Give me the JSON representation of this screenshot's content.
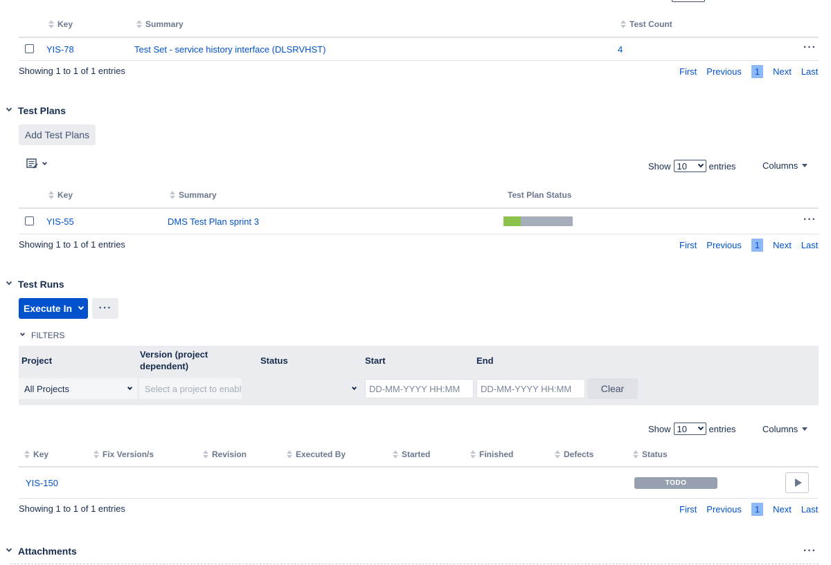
{
  "test_sets": {
    "columns": {
      "key": "Key",
      "summary": "Summary",
      "test_count": "Test Count"
    },
    "rows": [
      {
        "key": "YIS-78",
        "summary": "Test Set - service history interface (DLSRVHST)",
        "test_count": "4"
      }
    ],
    "showing": "Showing 1 to 1 of 1 entries"
  },
  "pager": {
    "first": "First",
    "previous": "Previous",
    "page": "1",
    "next": "Next",
    "last": "Last"
  },
  "test_plans": {
    "title": "Test Plans",
    "add_button": "Add Test Plans",
    "show_label": "Show",
    "show_value": "10",
    "entries_label": "entries",
    "columns_button": "Columns",
    "columns": {
      "key": "Key",
      "summary": "Summary",
      "status": "Test Plan Status"
    },
    "rows": [
      {
        "key": "YIS-55",
        "summary": "DMS Test Plan sprint 3",
        "passed_fraction": 0.25
      }
    ],
    "showing": "Showing 1 to 1 of 1 entries"
  },
  "test_runs": {
    "title": "Test Runs",
    "execute_button": "Execute In",
    "filters_label": "FILTERS",
    "filters": {
      "project_label": "Project",
      "project_value": "All Projects",
      "version_label": "Version (project dependent)",
      "version_placeholder": "Select a project to enable",
      "status_label": "Status",
      "start_label": "Start",
      "start_placeholder": "DD-MM-YYYY HH:MM",
      "end_label": "End",
      "end_placeholder": "DD-MM-YYYY HH:MM",
      "clear_button": "Clear"
    },
    "show_label": "Show",
    "show_value": "10",
    "entries_label": "entries",
    "columns_button": "Columns",
    "columns": {
      "key": "Key",
      "fix_version": "Fix Version/s",
      "revision": "Revision",
      "executed_by": "Executed By",
      "started": "Started",
      "finished": "Finished",
      "defects": "Defects",
      "status": "Status"
    },
    "rows": [
      {
        "key": "YIS-150",
        "status": "TODO"
      }
    ],
    "showing": "Showing 1 to 1 of 1 entries"
  },
  "attachments": {
    "title": "Attachments"
  },
  "colors": {
    "link": "#0052cc",
    "primary": "#0052cc",
    "passed": "#8bc34a",
    "remaining": "#a5adba",
    "todo": "#97a0af",
    "page_active": "#8fb8f6"
  },
  "icons": [
    "sort-icon",
    "chevron-down-icon",
    "ellipsis-icon",
    "column-picker-icon",
    "play-icon",
    "caret-down-icon"
  ]
}
